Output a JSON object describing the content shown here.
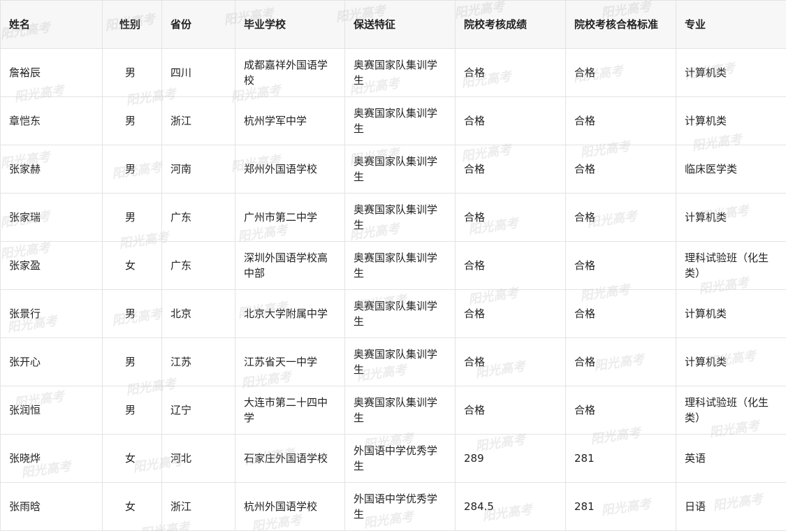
{
  "table": {
    "headers": [
      "姓名",
      "性别",
      "省份",
      "毕业学校",
      "保送特征",
      "院校考核成绩",
      "院校考核合格标准",
      "专业"
    ],
    "rows": [
      [
        "詹裕辰",
        "男",
        "四川",
        "成都嘉祥外国语学校",
        "奥赛国家队集训学生",
        "合格",
        "合格",
        "计算机类"
      ],
      [
        "章恺东",
        "男",
        "浙江",
        "杭州学军中学",
        "奥赛国家队集训学生",
        "合格",
        "合格",
        "计算机类"
      ],
      [
        "张家赫",
        "男",
        "河南",
        "郑州外国语学校",
        "奥赛国家队集训学生",
        "合格",
        "合格",
        "临床医学类"
      ],
      [
        "张家瑞",
        "男",
        "广东",
        "广州市第二中学",
        "奥赛国家队集训学生",
        "合格",
        "合格",
        "计算机类"
      ],
      [
        "张家盈",
        "女",
        "广东",
        "深圳外国语学校高中部",
        "奥赛国家队集训学生",
        "合格",
        "合格",
        "理科试验班（化生类）"
      ],
      [
        "张景行",
        "男",
        "北京",
        "北京大学附属中学",
        "奥赛国家队集训学生",
        "合格",
        "合格",
        "计算机类"
      ],
      [
        "张开心",
        "男",
        "江苏",
        "江苏省天一中学",
        "奥赛国家队集训学生",
        "合格",
        "合格",
        "计算机类"
      ],
      [
        "张润恒",
        "男",
        "辽宁",
        "大连市第二十四中学",
        "奥赛国家队集训学生",
        "合格",
        "合格",
        "理科试验班（化生类）"
      ],
      [
        "张晓烨",
        "女",
        "河北",
        "石家庄外国语学校",
        "外国语中学优秀学生",
        "289",
        "281",
        "英语"
      ],
      [
        "张雨晗",
        "女",
        "浙江",
        "杭州外国语学校",
        "外国语中学优秀学生",
        "284.5",
        "281",
        "日语"
      ]
    ]
  },
  "watermark": {
    "text": "阳光高考",
    "color": "#aaaaaa"
  }
}
